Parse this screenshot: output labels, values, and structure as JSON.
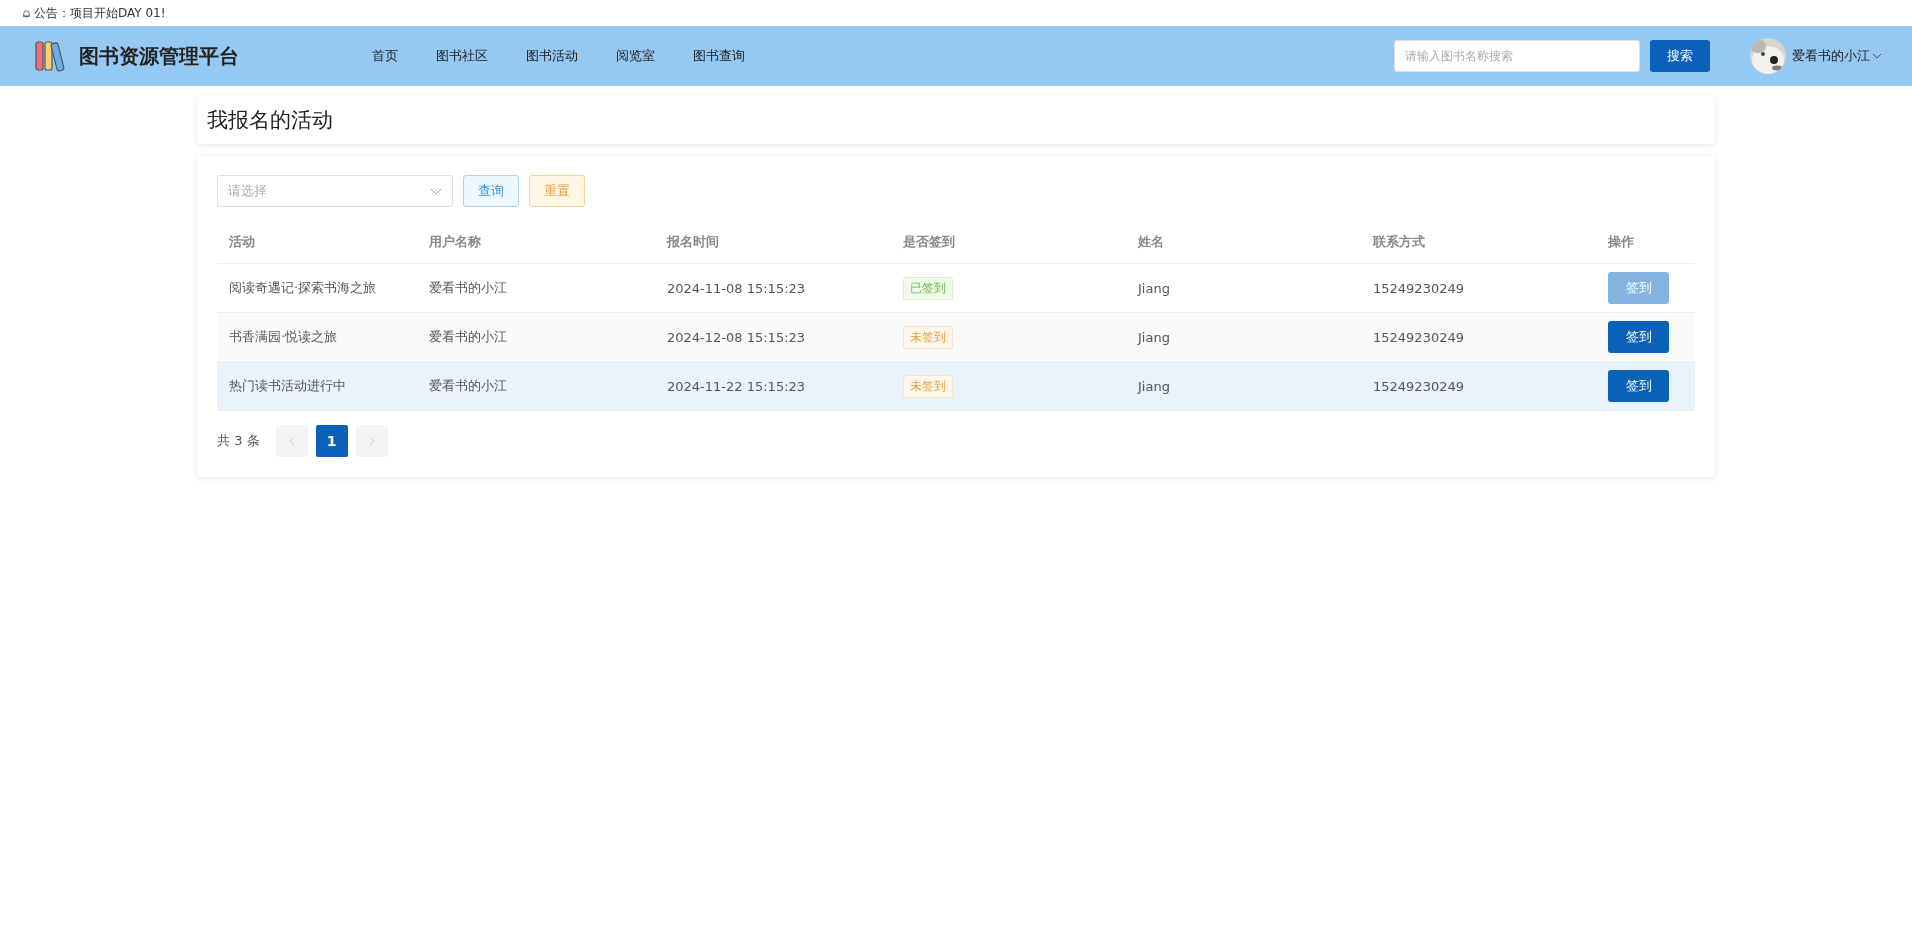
{
  "announcement": "公告：项目开始DAY 01!",
  "header": {
    "title": "图书资源管理平台",
    "nav": [
      {
        "label": "首页",
        "selected": false
      },
      {
        "label": "图书社区",
        "selected": false
      },
      {
        "label": "图书活动",
        "selected": false
      },
      {
        "label": "阅览室",
        "selected": false
      },
      {
        "label": "图书查询",
        "selected": false
      }
    ],
    "search": {
      "placeholder": "请输入图书名称搜索",
      "button": "搜索"
    },
    "user": {
      "name": "爱看书的小江"
    }
  },
  "page_title": "我报名的活动",
  "filter": {
    "select_placeholder": "请选择",
    "query_button": "查询",
    "reset_button": "重置"
  },
  "table": {
    "columns": [
      "活动",
      "用户名称",
      "报名时间",
      "是否签到",
      "姓名",
      "联系方式",
      "操作"
    ],
    "rows": [
      {
        "activity": "阅读奇遇记·探索书海之旅",
        "user": "爱看书的小江",
        "time": "2024-11-08 15:15:23",
        "status": "已签到",
        "signed": true,
        "name": "Jiang",
        "phone": "15249230249",
        "action": "签到",
        "highlighted": false
      },
      {
        "activity": "书香满园·悦读之旅",
        "user": "爱看书的小江",
        "time": "2024-12-08 15:15:23",
        "status": "未签到",
        "signed": false,
        "name": "Jiang",
        "phone": "15249230249",
        "action": "签到",
        "highlighted": false
      },
      {
        "activity": "热门读书活动进行中",
        "user": "爱看书的小江",
        "time": "2024-11-22 15:15:23",
        "status": "未签到",
        "signed": false,
        "name": "Jiang",
        "phone": "15249230249",
        "action": "签到",
        "highlighted": true
      }
    ]
  },
  "pagination": {
    "total": "共 3 条",
    "pages": [
      {
        "label": "1",
        "selected": true
      }
    ],
    "prev_disabled": true,
    "next_disabled": true
  }
}
